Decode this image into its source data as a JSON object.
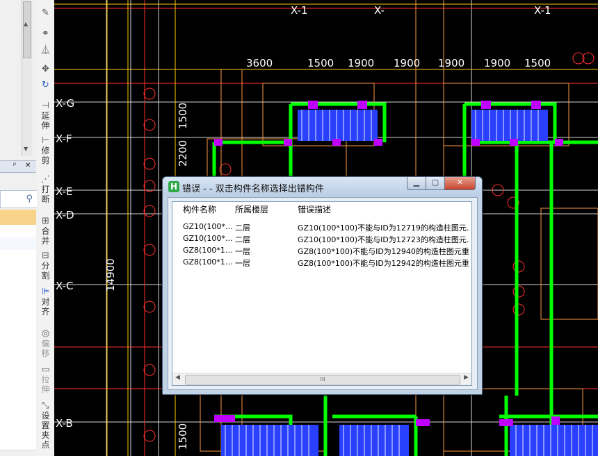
{
  "dialog": {
    "title": "错误 - - 双击构件名称选择出错构件",
    "columns": [
      "构件名称",
      "所属楼层",
      "错误描述"
    ],
    "rows": [
      {
        "name": "GZ10(100*…",
        "floor": "二层",
        "desc": "GZ10(100*100)不能与ID为12719的构造柱图元…"
      },
      {
        "name": "GZ10(100*…",
        "floor": "二层",
        "desc": "GZ10(100*100)不能与ID为12723的构造柱图元…"
      },
      {
        "name": "GZ8(100*1…",
        "floor": "一层",
        "desc": "GZ8(100*100)不能与ID为12940的构造柱图元重…"
      },
      {
        "name": "GZ8(100*1…",
        "floor": "一层",
        "desc": "GZ8(100*100)不能与ID为12942的构造柱图元重…"
      }
    ],
    "scroll_grip": "III"
  },
  "toolbar": {
    "tools": [
      {
        "label": "延伸",
        "icon": "extend-icon"
      },
      {
        "label": "修剪",
        "icon": "trim-icon"
      },
      {
        "label": "打断",
        "icon": "break-icon"
      },
      {
        "label": "合并",
        "icon": "merge-icon"
      },
      {
        "label": "分割",
        "icon": "split-icon"
      },
      {
        "label": "对齐",
        "icon": "align-icon"
      },
      {
        "label": "偏移",
        "icon": "offset-icon"
      },
      {
        "label": "拉伸",
        "icon": "stretch-icon"
      },
      {
        "label": "设置夹点",
        "icon": "grip-icon"
      }
    ]
  },
  "left_panel": {
    "pin_glyph": "ᵖ",
    "close_glyph": "✕"
  },
  "cad": {
    "dims_top": [
      "3600",
      "1500",
      "1900",
      "1900",
      "1900",
      "1900",
      "1500"
    ],
    "dims_vertical": [
      "1500",
      "2200",
      "14900",
      "1500"
    ],
    "axis_labels": [
      "X-G",
      "X-F",
      "X-E",
      "X-D",
      "X-C",
      "X-B"
    ],
    "top_labels": [
      "X-1",
      "X-",
      "X-1"
    ]
  },
  "colors": {
    "wall_green": "#00ff00",
    "grid_red": "#ff3030",
    "dim_yellow": "#ffcc00",
    "column_blue": "#2a40ff",
    "magenta": "#c000ff"
  }
}
